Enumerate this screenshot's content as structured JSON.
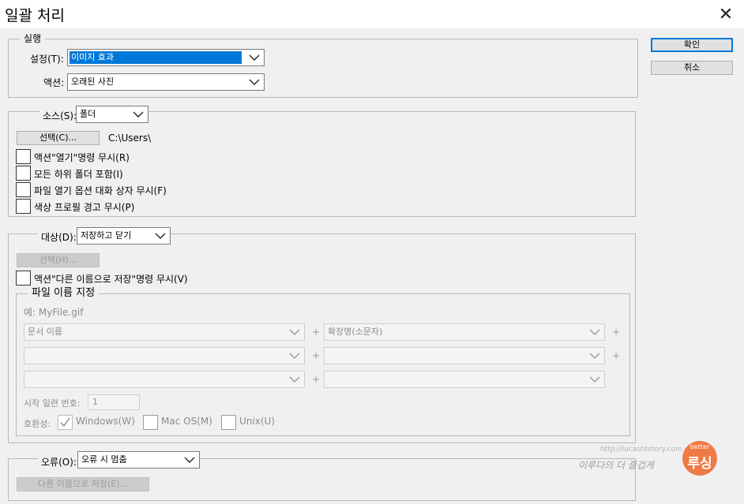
{
  "window": {
    "title": "일괄 처리"
  },
  "buttons": {
    "ok": "확인",
    "cancel": "취소"
  },
  "run": {
    "legend": "실행",
    "set_label": "설정(T):",
    "set_value": "이미지 효과",
    "action_label": "액션:",
    "action_value": "오래된 사진"
  },
  "source": {
    "label": "소스(S):",
    "value": "폴더",
    "choose_button": "선택(C)...",
    "path": "C:\\Users\\",
    "options": [
      "액션\"열기\"명령 무시(R)",
      "모든 하위 폴더 포함(I)",
      "파일 열기 옵션 대화 상자 무시(F)",
      "색상 프로필 경고 무시(P)"
    ]
  },
  "destination": {
    "label": "대상(D):",
    "value": "저장하고 닫기",
    "choose_button": "선택(H)...",
    "override_save": "액션\"다른 이름으로 저장\"명령 무시(V)",
    "naming": {
      "legend": "파일 이름 지정",
      "example": "예: MyFile.gif",
      "rows": [
        [
          "문서 이름",
          "확장명(소문자)"
        ],
        [
          "",
          ""
        ],
        [
          "",
          ""
        ]
      ],
      "plus": "+",
      "serial_label": "시작 일련 번호:",
      "serial_value": "1",
      "compat_label": "호환성:",
      "compat": [
        "Windows(W)",
        "Mac OS(M)",
        "Unix(U)"
      ],
      "compat_checked": [
        true,
        false,
        false
      ]
    }
  },
  "errors": {
    "label": "오류(O):",
    "value": "오류 시 멈춤",
    "save_as_button": "다른 이름으로 저장(E)..."
  },
  "watermark": {
    "url": "http://lucashtstory.com",
    "tagline": "이루다의 더 즐겁게",
    "badge_top": "better",
    "badge_main": "루싱"
  },
  "colors": {
    "accent": "#0078d7",
    "disabled_text": "#8c8c8c",
    "badge": "#f07a45"
  }
}
